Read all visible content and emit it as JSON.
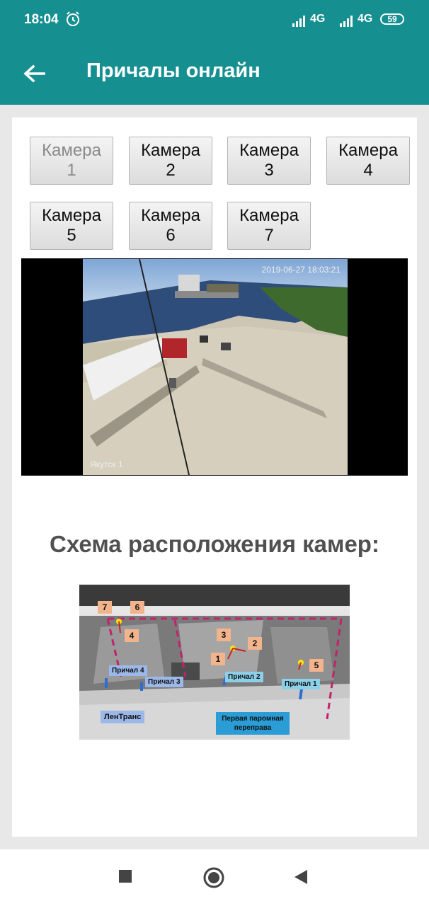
{
  "status": {
    "time": "18:04",
    "net1": "4G",
    "net2": "4G",
    "battery": "59"
  },
  "appbar": {
    "title": "Причалы онлайн"
  },
  "cameras": [
    {
      "label": "Камера",
      "num": "1",
      "enabled": false
    },
    {
      "label": "Камера",
      "num": "2",
      "enabled": true
    },
    {
      "label": "Камера",
      "num": "3",
      "enabled": true
    },
    {
      "label": "Камера",
      "num": "4",
      "enabled": true
    },
    {
      "label": "Камера",
      "num": "5",
      "enabled": true
    },
    {
      "label": "Камера",
      "num": "6",
      "enabled": true
    },
    {
      "label": "Камера",
      "num": "7",
      "enabled": true
    }
  ],
  "video": {
    "timestamp": "2019-06-27 18:03:21",
    "location": "Якутск 1"
  },
  "schema": {
    "title": "Схема расположения камер:",
    "markers": [
      "7",
      "6",
      "4",
      "3",
      "2",
      "1",
      "5"
    ],
    "piers": [
      "Причал 4",
      "Причал 3",
      "Причал 2",
      "Причал 1"
    ],
    "lentrans": "ЛенТранс",
    "ferry": "Первая паромная переправа"
  },
  "colors": {
    "accent": "#168f91"
  }
}
